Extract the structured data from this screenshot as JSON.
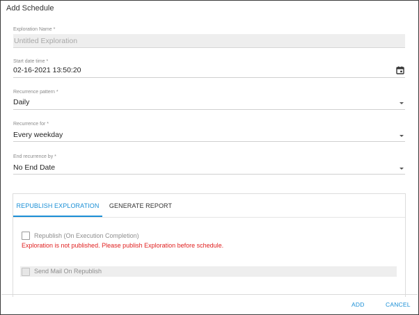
{
  "dialog": {
    "title": "Add Schedule"
  },
  "form": {
    "exploration_name": {
      "label": "Exploration Name *",
      "value": "Untitled Exploration"
    },
    "start_datetime": {
      "label": "Start date time *",
      "value": "02-16-2021 13:50:20",
      "icon": "calendar-icon"
    },
    "recurrence_pattern": {
      "label": "Recurrence pattern *",
      "value": "Daily"
    },
    "recurrence_for": {
      "label": "Recurrence for *",
      "value": "Every weekday"
    },
    "end_recurrence": {
      "label": "End recurrence by *",
      "value": "No End Date"
    }
  },
  "tabs": {
    "items": [
      {
        "label": "REPUBLISH EXPLORATION",
        "active": true
      },
      {
        "label": "GENERATE REPORT",
        "active": false
      }
    ],
    "accent_color": "#1a8fd6"
  },
  "republish": {
    "checkbox_label": "Republish (On Execution Completion)",
    "error_message": "Exploration is not published. Please publish Exploration before schedule.",
    "send_mail_label": "Send Mail On Republish",
    "error_color": "#e02020"
  },
  "footer": {
    "add_label": "ADD",
    "cancel_label": "CANCEL"
  }
}
